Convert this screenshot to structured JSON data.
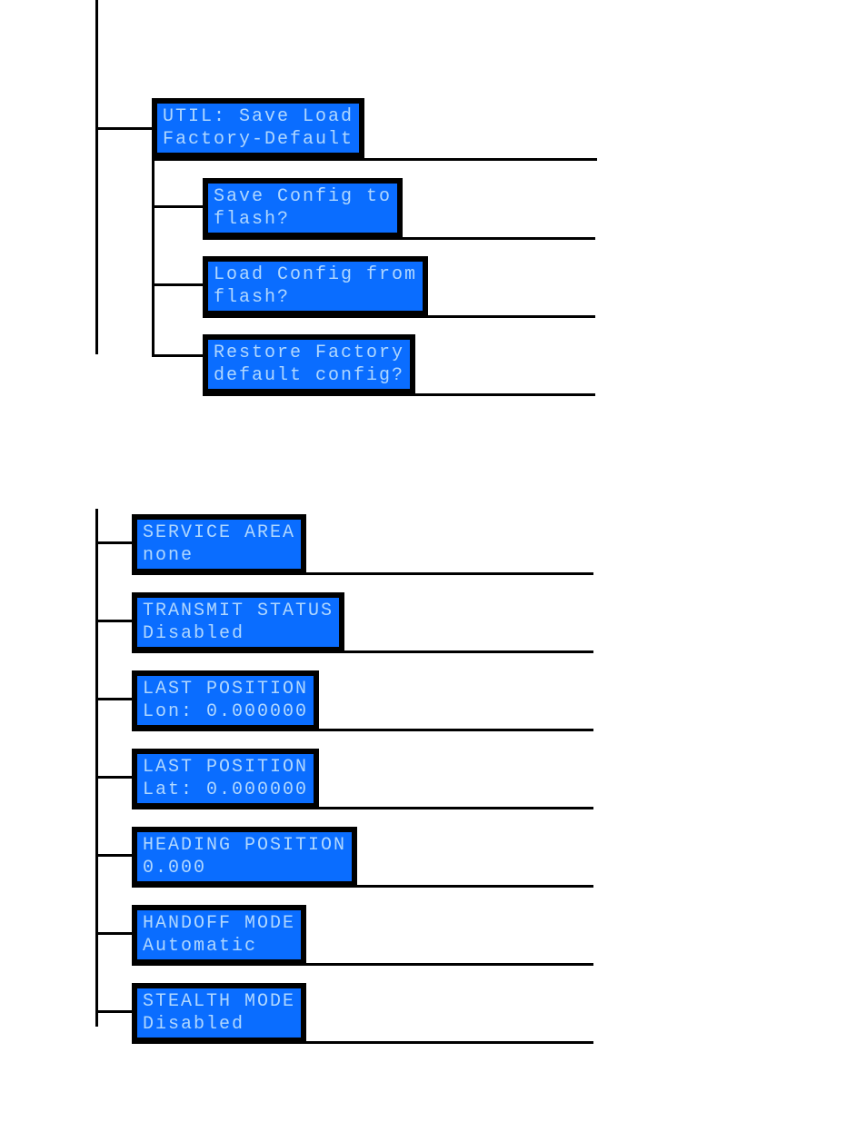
{
  "tree1": {
    "root": "UTIL: Save Load\nFactory-Default",
    "children": [
      "Save Config to\nflash?",
      "Load Config from\nflash?",
      "Restore Factory\ndefault config?"
    ]
  },
  "tree2": {
    "items": [
      "SERVICE AREA\nnone",
      "TRANSMIT STATUS\nDisabled",
      "LAST POSITION\nLon: 0.000000",
      "LAST POSITION\nLat: 0.000000",
      "HEADING POSITION\n0.000",
      "HANDOFF MODE\nAutomatic",
      "STEALTH MODE\nDisabled"
    ]
  }
}
